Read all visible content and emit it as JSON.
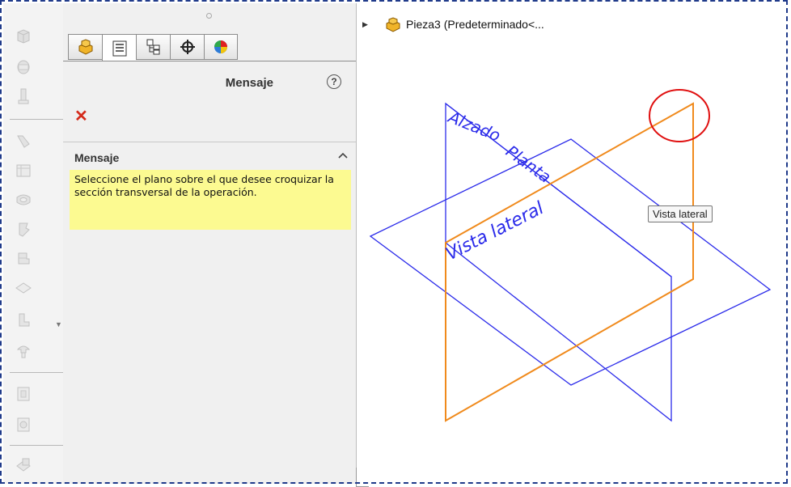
{
  "toolbar": {
    "icons": [
      "extrude-boss-icon",
      "revolve-boss-icon",
      "swept-boss-icon",
      "lofted-boss-icon",
      "boundary-boss-icon",
      "extruded-cut-icon",
      "hole-wizard-icon",
      "revolved-cut-icon",
      "swept-cut-icon",
      "lofted-cut-icon",
      "fillet-icon",
      "linear-pattern-icon",
      "rib-icon",
      "draft-icon",
      "shell-icon",
      "wrap-icon"
    ]
  },
  "panel": {
    "tabs": [
      "feature-manager-icon",
      "property-manager-icon",
      "configuration-manager-icon",
      "dimxpert-icon",
      "display-manager-icon"
    ],
    "title": "Mensaje",
    "message_section": {
      "title": "Mensaje",
      "text": "Seleccione el plano sobre el que desee croquizar la sección transversal de la operación."
    }
  },
  "tree": {
    "part_label": "Pieza3  (Predeterminado<..."
  },
  "viewport": {
    "plane_labels": {
      "front": "Alzado",
      "top": "Planta",
      "right": "Vista lateral"
    },
    "tooltip": "Vista lateral",
    "colors": {
      "plane": "#2b2bea",
      "highlight": "#f08a1c",
      "circle": "#e01010"
    }
  }
}
